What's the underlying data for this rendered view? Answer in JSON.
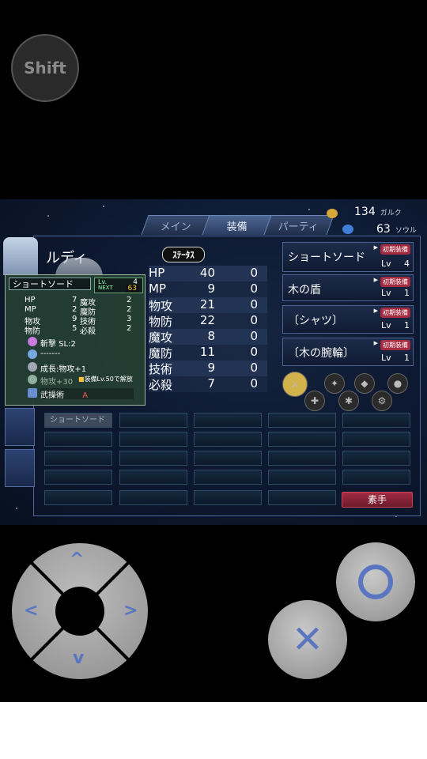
{
  "overlay": {
    "shift_label": "Shift"
  },
  "tabs": [
    {
      "label": "メイン",
      "active": false
    },
    {
      "label": "装備",
      "active": true
    },
    {
      "label": "パーティ",
      "active": false
    }
  ],
  "currency": {
    "gold": {
      "value": "134",
      "unit": "ガルク"
    },
    "soul": {
      "value": "63",
      "unit": "ソウル"
    }
  },
  "character": {
    "name": "ルディ",
    "status_label": "ｽﾃｰﾀｽ"
  },
  "stats": [
    {
      "name": "HP",
      "value": "40",
      "bonus": "0"
    },
    {
      "name": "MP",
      "value": "9",
      "bonus": "0"
    },
    {
      "name": "物攻",
      "value": "21",
      "bonus": "0"
    },
    {
      "name": "物防",
      "value": "22",
      "bonus": "0"
    },
    {
      "name": "魔攻",
      "value": "8",
      "bonus": "0"
    },
    {
      "name": "魔防",
      "value": "11",
      "bonus": "0"
    },
    {
      "name": "技術",
      "value": "9",
      "bonus": "0"
    },
    {
      "name": "必殺",
      "value": "7",
      "bonus": "0"
    }
  ],
  "equipment": [
    {
      "name": "ショートソード",
      "badge": "初期装備",
      "lv_label": "Lv",
      "lv": "4"
    },
    {
      "name": "木の盾",
      "badge": "初期装備",
      "lv_label": "Lv",
      "lv": "1"
    },
    {
      "name": "〔シャツ〕",
      "badge": "初期装備",
      "lv_label": "Lv",
      "lv": "1"
    },
    {
      "name": "〔木の腕輪〕",
      "badge": "初期装備",
      "lv_label": "Lv",
      "lv": "1"
    }
  ],
  "inventory": {
    "first_item": "ショートソード",
    "sort_label": "素手"
  },
  "tooltip": {
    "title": "ショートソード",
    "lv_label": "Lv.",
    "lv": "4",
    "next_label": "NEXT",
    "next": "63",
    "stats_left": [
      {
        "name": "HP",
        "value": "7"
      },
      {
        "name": "MP",
        "value": "2"
      },
      {
        "name": "物攻",
        "value": "9"
      },
      {
        "name": "物防",
        "value": "5"
      }
    ],
    "stats_right": [
      {
        "name": "魔攻",
        "value": "2"
      },
      {
        "name": "魔防",
        "value": "2"
      },
      {
        "name": "技術",
        "value": "3"
      },
      {
        "name": "必殺",
        "value": "2"
      }
    ],
    "skill1": "斬撃 SL:2",
    "skill2": "-------",
    "growth": "成長:物攻+1",
    "req": "物攻+30",
    "unlock": "装備Lv.50で解放",
    "weapon_type": "武操術",
    "weapon_rank": "A"
  },
  "controls": {
    "arrows": [
      "^",
      "<",
      ">",
      "v"
    ]
  },
  "colors": {
    "accent_blue": "#5a76c0",
    "badge_red": "#a42a40",
    "panel_border": "#50679a"
  }
}
